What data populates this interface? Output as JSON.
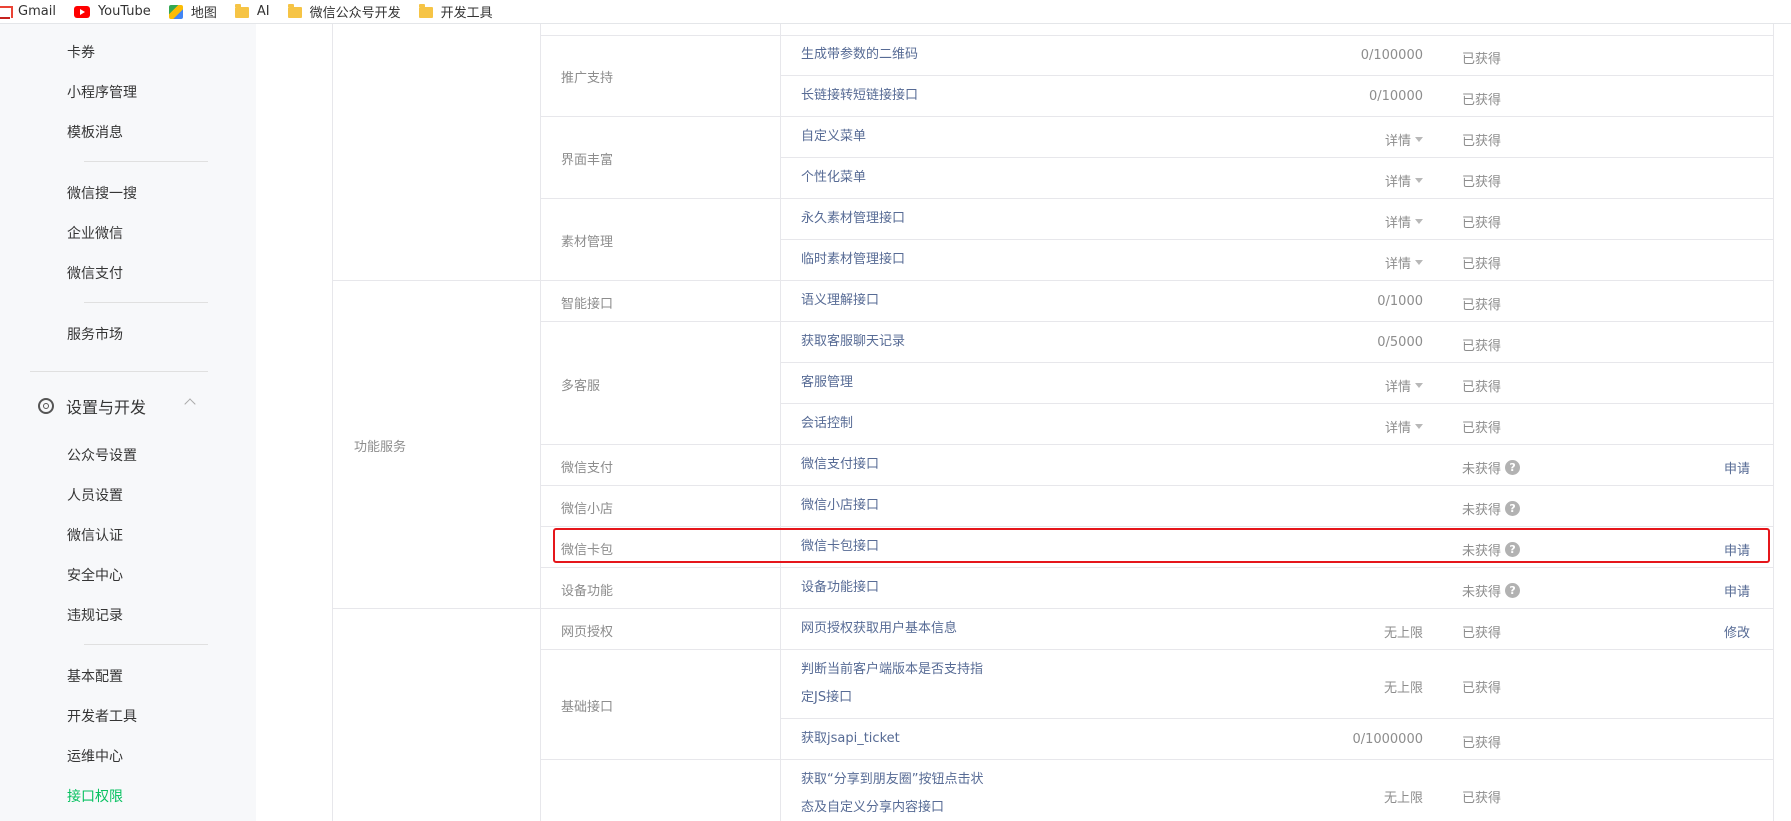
{
  "bookmarks": [
    "Gmail",
    "YouTube",
    "地图",
    "AI",
    "微信公众号开发",
    "开发工具"
  ],
  "sidebar": {
    "items_top": [
      "卡券",
      "小程序管理",
      "模板消息"
    ],
    "items_mid": [
      "微信搜一搜",
      "企业微信",
      "微信支付"
    ],
    "items_market": [
      "服务市场"
    ],
    "group_label": "设置与开发",
    "items_settings": [
      "公众号设置",
      "人员设置",
      "微信认证",
      "安全中心",
      "违规记录"
    ],
    "items_dev": [
      "基本配置",
      "开发者工具",
      "运维中心",
      "接口权限"
    ]
  },
  "table": {
    "category": "功能服务",
    "groups": {
      "promotion": "推广支持",
      "ui": "界面丰富",
      "material": "素材管理",
      "smart": "智能接口",
      "kefu": "多客服",
      "pay": "微信支付",
      "shop": "微信小店",
      "card": "微信卡包",
      "device": "设备功能",
      "web_auth": "网页授权",
      "basic": "基础接口"
    },
    "rows": [
      {
        "api": "生成带参数的二维码",
        "quota": "0/100000",
        "status": "已获得",
        "action": ""
      },
      {
        "api": "长链接转短链接接口",
        "quota": "0/10000",
        "status": "已获得",
        "action": ""
      },
      {
        "api": "自定义菜单",
        "quota": "详情",
        "status": "已获得",
        "action": ""
      },
      {
        "api": "个性化菜单",
        "quota": "详情",
        "status": "已获得",
        "action": ""
      },
      {
        "api": "永久素材管理接口",
        "quota": "详情",
        "status": "已获得",
        "action": ""
      },
      {
        "api": "临时素材管理接口",
        "quota": "详情",
        "status": "已获得",
        "action": ""
      },
      {
        "api": "语义理解接口",
        "quota": "0/1000",
        "status": "已获得",
        "action": ""
      },
      {
        "api": "获取客服聊天记录",
        "quota": "0/5000",
        "status": "已获得",
        "action": ""
      },
      {
        "api": "客服管理",
        "quota": "详情",
        "status": "已获得",
        "action": ""
      },
      {
        "api": "会话控制",
        "quota": "详情",
        "status": "已获得",
        "action": ""
      },
      {
        "api": "微信支付接口",
        "quota": "",
        "status": "未获得",
        "action": "申请"
      },
      {
        "api": "微信小店接口",
        "quota": "",
        "status": "未获得",
        "action": ""
      },
      {
        "api": "微信卡包接口",
        "quota": "",
        "status": "未获得",
        "action": "申请"
      },
      {
        "api": "设备功能接口",
        "quota": "",
        "status": "未获得",
        "action": "申请"
      },
      {
        "api": "网页授权获取用户基本信息",
        "quota": "无上限",
        "status": "已获得",
        "action": "修改"
      },
      {
        "api_line1": "判断当前客户端版本是否支持指",
        "api_line2": "定JS接口",
        "quota": "无上限",
        "status": "已获得",
        "action": ""
      },
      {
        "api": "获取jsapi_ticket",
        "quota": "0/1000000",
        "status": "已获得",
        "action": ""
      },
      {
        "api_line1": "获取“分享到朋友圈”按钮点击状",
        "api_line2": "态及自定义分享内容接口",
        "quota": "无上限",
        "status": "已获得",
        "action": ""
      }
    ],
    "help_glyph": "?"
  },
  "colors": {
    "link": "#576b95",
    "active": "#07c160",
    "highlight": "#e5161b"
  }
}
